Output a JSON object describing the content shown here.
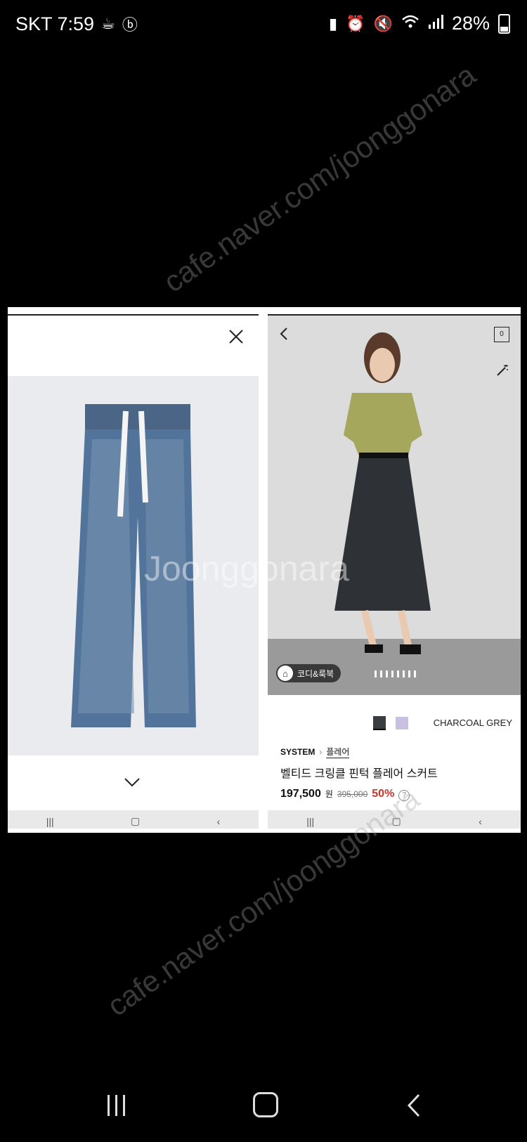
{
  "status_bar": {
    "carrier_time": "SKT 7:59",
    "battery_percent": "28%"
  },
  "left_panel": {
    "product_image": "wide-leg-denim-jeans",
    "nav_icons": [
      "recent-apps-icon",
      "home-icon",
      "back-icon"
    ]
  },
  "right_panel": {
    "bag_count": "0",
    "coordi_label": "코디&룩북",
    "color_name": "CHARCOAL GREY",
    "brand": "SYSTEM",
    "category": "플레어",
    "product_name": "벨티드 크링클 핀턱 플레어 스커트",
    "price": "197,500",
    "currency": "원",
    "original_price": "395,000",
    "discount": "50%",
    "help_icon": "?",
    "swatches": [
      "#3a3d40",
      "#c9bfe0"
    ]
  },
  "watermarks": [
    "cafe.naver.com/joonggonara",
    "Joonggonara",
    "cafe.naver.com/joonggonara"
  ]
}
